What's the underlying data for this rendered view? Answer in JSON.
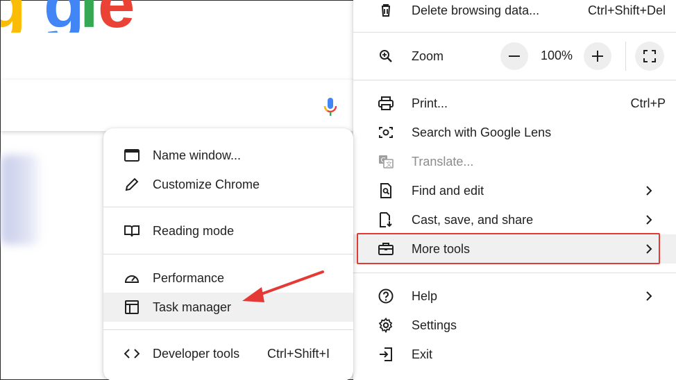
{
  "background": {
    "logo_letters": [
      "g",
      "l",
      "e"
    ],
    "brand_colors": {
      "blue": "#4285F4",
      "red": "#EA4335",
      "yellow": "#FBBC05",
      "green": "#34A853"
    }
  },
  "main_menu": {
    "delete_browsing": {
      "label": "Delete browsing data...",
      "shortcut": "Ctrl+Shift+Del"
    },
    "zoom": {
      "label": "Zoom",
      "minus": "−",
      "value": "100%",
      "plus": "+"
    },
    "print": {
      "label": "Print...",
      "shortcut": "Ctrl+P"
    },
    "lens": {
      "label": "Search with Google Lens"
    },
    "translate": {
      "label": "Translate..."
    },
    "find_edit": {
      "label": "Find and edit"
    },
    "cast": {
      "label": "Cast, save, and share"
    },
    "more_tools": {
      "label": "More tools"
    },
    "help": {
      "label": "Help"
    },
    "settings": {
      "label": "Settings"
    },
    "exit": {
      "label": "Exit"
    }
  },
  "sub_menu": {
    "name_window": {
      "label": "Name window..."
    },
    "customize": {
      "label": "Customize Chrome"
    },
    "reading_mode": {
      "label": "Reading mode"
    },
    "performance": {
      "label": "Performance"
    },
    "task_manager": {
      "label": "Task manager"
    },
    "dev_tools": {
      "label": "Developer tools",
      "shortcut": "Ctrl+Shift+I"
    }
  },
  "annotation": {
    "outline_color": "#e53935",
    "arrow_color": "#e53935"
  }
}
